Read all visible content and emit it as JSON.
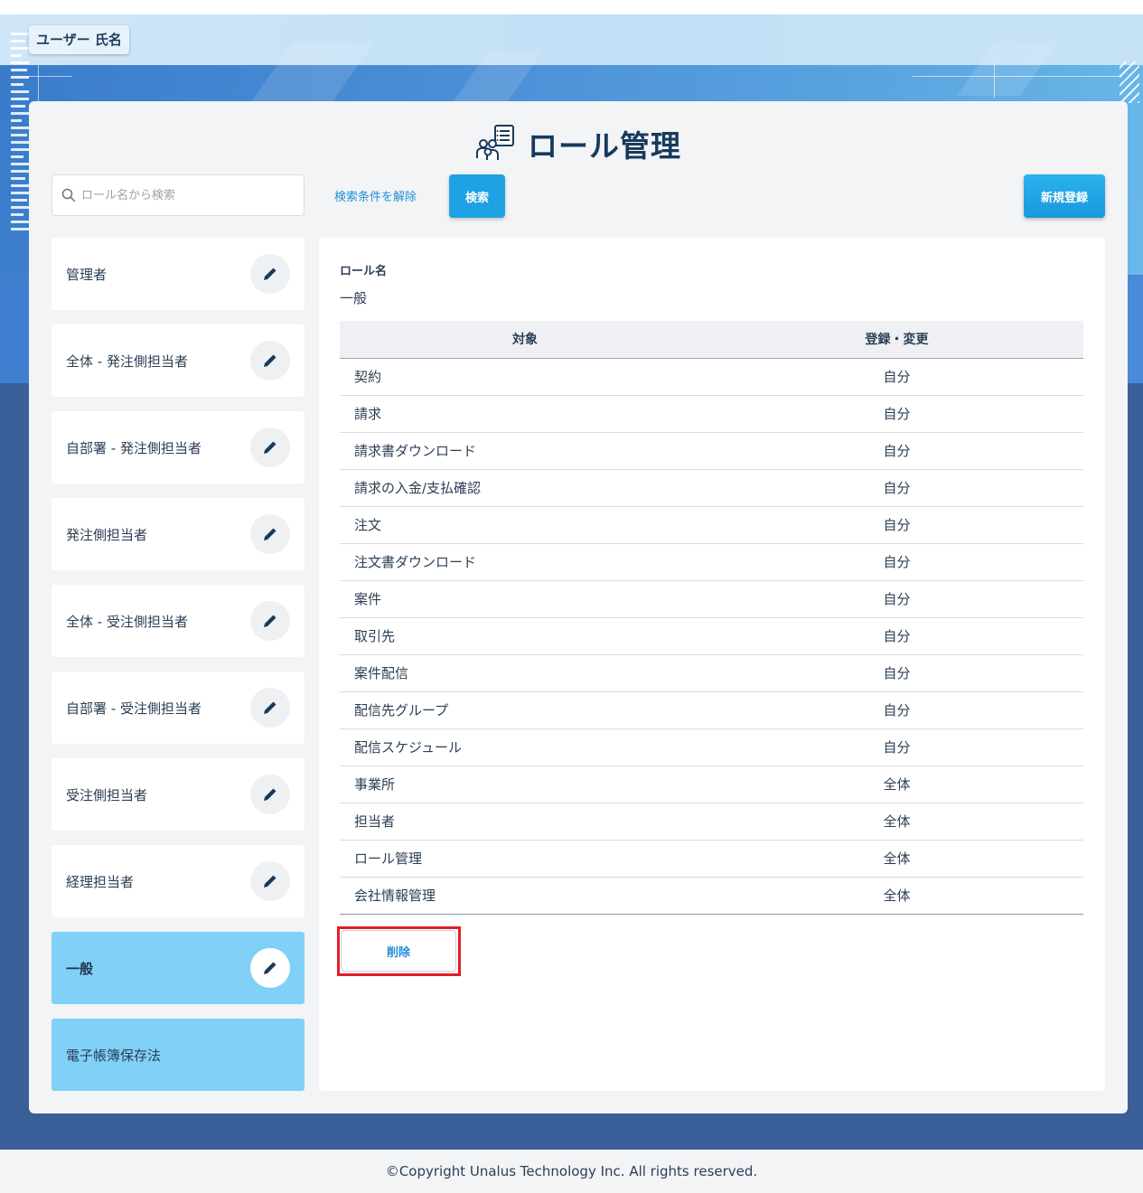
{
  "header": {
    "user_name": "ユーザー 氏名"
  },
  "page": {
    "title": "ロール管理",
    "title_icon": "role-management-icon"
  },
  "search": {
    "placeholder": "ロール名から検索",
    "clear_label": "検索条件を解除",
    "search_label": "検索",
    "new_label": "新規登録"
  },
  "roles": [
    {
      "name": "管理者",
      "editable": true
    },
    {
      "name": "全体 - 発注側担当者",
      "editable": true
    },
    {
      "name": "自部署 - 発注側担当者",
      "editable": true
    },
    {
      "name": "発注側担当者",
      "editable": true
    },
    {
      "name": "全体 - 受注側担当者",
      "editable": true
    },
    {
      "name": "自部署 - 受注側担当者",
      "editable": true
    },
    {
      "name": "受注側担当者",
      "editable": true
    },
    {
      "name": "経理担当者",
      "editable": true
    },
    {
      "name": "一般",
      "editable": true,
      "selected": true
    },
    {
      "name": "電子帳簿保存法",
      "editable": false
    }
  ],
  "detail": {
    "role_label": "ロール名",
    "role_value": "一般",
    "columns": [
      "対象",
      "登録・変更"
    ],
    "rows": [
      [
        "契約",
        "自分"
      ],
      [
        "請求",
        "自分"
      ],
      [
        "請求書ダウンロード",
        "自分"
      ],
      [
        "請求の入金/支払確認",
        "自分"
      ],
      [
        "注文",
        "自分"
      ],
      [
        "注文書ダウンロード",
        "自分"
      ],
      [
        "案件",
        "自分"
      ],
      [
        "取引先",
        "自分"
      ],
      [
        "案件配信",
        "自分"
      ],
      [
        "配信先グループ",
        "自分"
      ],
      [
        "配信スケジュール",
        "自分"
      ],
      [
        "事業所",
        "全体"
      ],
      [
        "担当者",
        "全体"
      ],
      [
        "ロール管理",
        "全体"
      ],
      [
        "会社情報管理",
        "全体"
      ]
    ],
    "delete_label": "削除"
  },
  "footer": {
    "copyright": "©Copyright Unalus Technology Inc. All rights reserved."
  },
  "colors": {
    "accent": "#1ea2e4",
    "selected_role": "#80d0f8",
    "highlight": "#e01f26",
    "title": "#173a5c"
  }
}
